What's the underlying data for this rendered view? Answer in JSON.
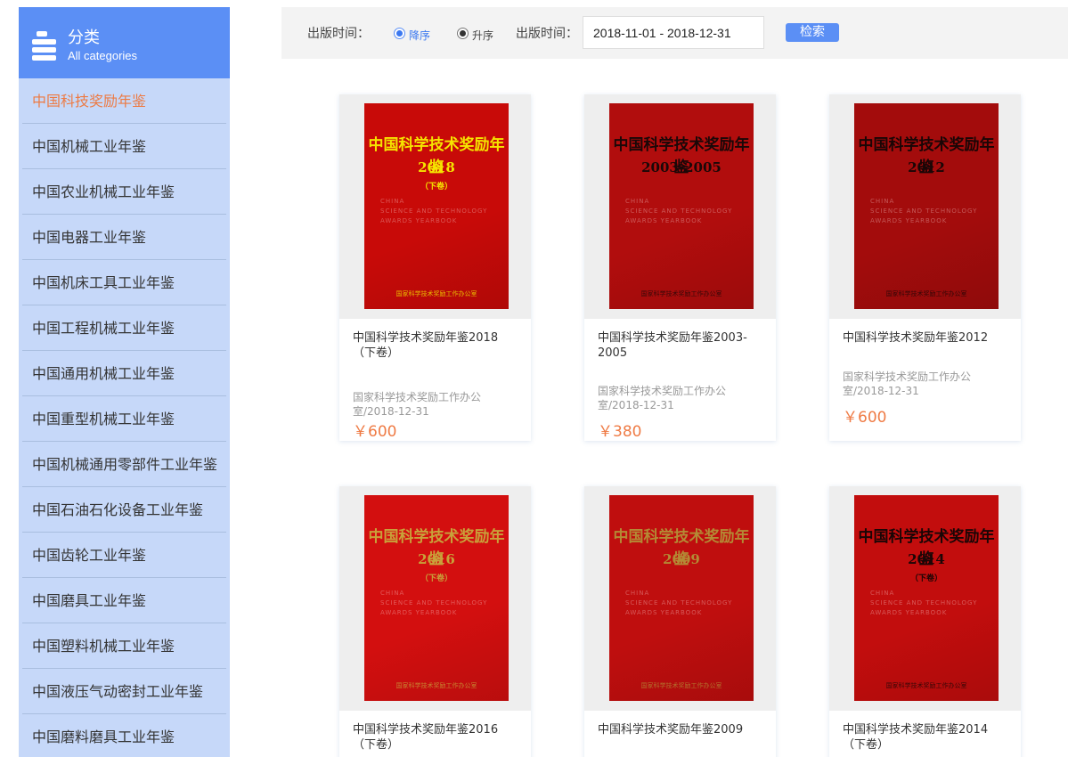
{
  "sidebar": {
    "title_zh": "分类",
    "title_en": "All categories",
    "items": [
      {
        "label": "中国科技奖励年鉴",
        "active": true
      },
      {
        "label": "中国机械工业年鉴"
      },
      {
        "label": "中国农业机械工业年鉴"
      },
      {
        "label": "中国电器工业年鉴"
      },
      {
        "label": "中国机床工具工业年鉴"
      },
      {
        "label": "中国工程机械工业年鉴"
      },
      {
        "label": "中国通用机械工业年鉴"
      },
      {
        "label": "中国重型机械工业年鉴"
      },
      {
        "label": "中国机械通用零部件工业年鉴"
      },
      {
        "label": "中国石油石化设备工业年鉴"
      },
      {
        "label": "中国齿轮工业年鉴"
      },
      {
        "label": "中国磨具工业年鉴"
      },
      {
        "label": "中国塑料机械工业年鉴"
      },
      {
        "label": "中国液压气动密封工业年鉴"
      },
      {
        "label": "中国磨料磨具工业年鉴"
      }
    ]
  },
  "filter": {
    "sort_label": "出版时间：",
    "desc_label": "降序",
    "asc_label": "升序",
    "selected_sort": "desc",
    "date_label": "出版时间：",
    "date_range": "2018-11-01 - 2018-12-31",
    "search_button": "检索"
  },
  "books": [
    {
      "title": "中国科学技术奖励年鉴2018（下卷）",
      "publisher": "国家科学技术奖励工作办公室/2018-12-31",
      "price": "￥600",
      "cover": {
        "title": "中国科学技术奖励年鉴",
        "year": "2018",
        "sub": "（下卷）",
        "bottom": "国家科学技术奖励工作办公室",
        "english": "CHINA\nSCIENCE AND TECHNOLOGY\nAWARDS YEARBOOK",
        "bg": "#c80a08",
        "fg": "#f5e400"
      }
    },
    {
      "title": "中国科学技术奖励年鉴2003-2005",
      "publisher": "国家科学技术奖励工作办公室/2018-12-31",
      "price": "￥380",
      "cover": {
        "title": "中国科学技术奖励年鉴",
        "year": "2003-2005",
        "sub": "",
        "bottom": "国家科学技术奖励工作办公室",
        "english": "CHINA\nSCIENCE AND TECHNOLOGY\nAWARDS YEARBOOK",
        "bg": "#b10d0d",
        "fg": "#1a0808"
      }
    },
    {
      "title": "中国科学技术奖励年鉴2012",
      "publisher": "国家科学技术奖励工作办公室/2018-12-31",
      "price": "￥600",
      "cover": {
        "title": "中国科学技术奖励年鉴",
        "year": "2012",
        "sub": "",
        "bottom": "国家科学技术奖励工作办公室",
        "english": "CHINA\nSCIENCE AND TECHNOLOGY\nAWARDS YEARBOOK",
        "bg": "#a30c0c",
        "fg": "#1a0606"
      }
    },
    {
      "title": "中国科学技术奖励年鉴2016（下卷）",
      "publisher": "",
      "price": "",
      "cover": {
        "title": "中国科学技术奖励年鉴",
        "year": "2016",
        "sub": "（下卷）",
        "bottom": "国家科学技术奖励工作办公室",
        "english": "CHINA\nSCIENCE AND TECHNOLOGY\nAWARDS YEARBOOK",
        "bg": "#d30f0f",
        "fg": "#c9a13a"
      }
    },
    {
      "title": "中国科学技术奖励年鉴2009",
      "publisher": "",
      "price": "",
      "cover": {
        "title": "中国科学技术奖励年鉴",
        "year": "2009",
        "sub": "",
        "bottom": "国家科学技术奖励工作办公室",
        "english": "CHINA\nSCIENCE AND TECHNOLOGY\nAWARDS YEARBOOK",
        "bg": "#bf0e0e",
        "fg": "#b48a35"
      }
    },
    {
      "title": "中国科学技术奖励年鉴2014（下卷）",
      "publisher": "",
      "price": "",
      "cover": {
        "title": "中国科学技术奖励年鉴",
        "year": "2014",
        "sub": "（下卷）",
        "bottom": "国家科学技术奖励工作办公室",
        "english": "CHINA\nSCIENCE AND TECHNOLOGY\nAWARDS YEARBOOK",
        "bg": "#c20d0d",
        "fg": "#1a0606"
      }
    }
  ],
  "colors": {
    "accent": "#5b8ff5",
    "sidebar_bg": "#c6d8f9",
    "active_text": "#ed7a43",
    "price": "#ef7b45"
  },
  "icons": {
    "sidebar_header": "stacked-books-icon"
  }
}
